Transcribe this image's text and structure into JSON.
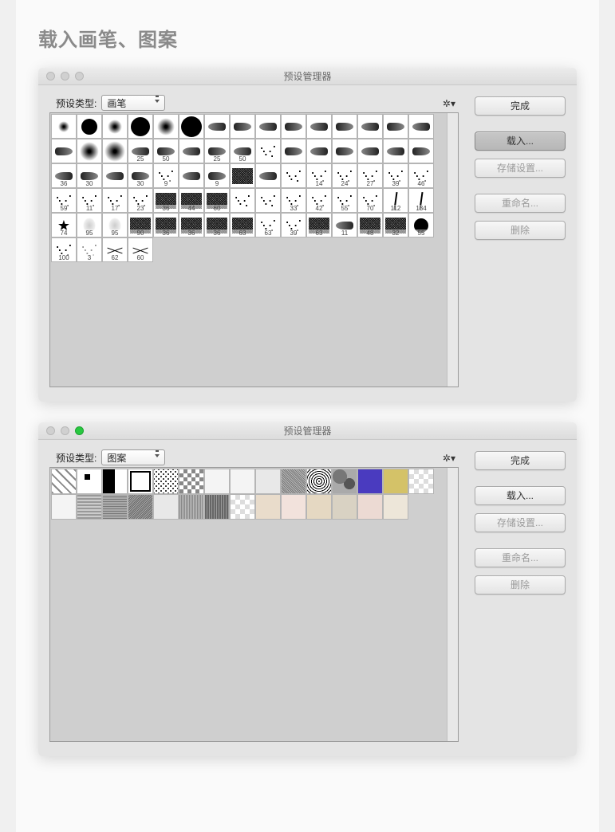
{
  "page": {
    "title": "载入画笔、图案"
  },
  "window1": {
    "title": "预设管理器",
    "type_label": "预设类型:",
    "type_value": "画笔",
    "buttons": {
      "done": "完成",
      "load": "载入...",
      "save": "存储设置...",
      "rename": "重命名...",
      "delete": "删除"
    },
    "brush_sizes_row3": [
      "",
      "",
      "25",
      "50",
      "",
      "25",
      "50",
      "",
      "",
      ""
    ],
    "brush_sizes_row4": [
      "",
      "",
      "36",
      "30",
      "",
      "30",
      "",
      "",
      "",
      ""
    ],
    "brush_sizes_row5": [
      "27",
      "39",
      "46",
      "59",
      "11",
      "17",
      "23",
      "36",
      "44",
      "60",
      "",
      "",
      "",
      ""
    ],
    "brush_sizes_row6": [
      "55",
      "70",
      "112",
      "134",
      "74",
      "95",
      "95",
      "90",
      "36",
      "36",
      "36",
      "63",
      "",
      ""
    ],
    "brush_sizes_row7": [
      "63",
      "11",
      "48",
      "32",
      "55",
      "100",
      "3",
      "62",
      "60"
    ],
    "brush_sizes_extra": [
      "9",
      "14",
      "24",
      "33",
      "42",
      "63",
      "39"
    ]
  },
  "window2": {
    "title": "预设管理器",
    "type_label": "预设类型:",
    "type_value": "图案",
    "buttons": {
      "done": "完成",
      "load": "载入...",
      "save": "存储设置...",
      "rename": "重命名...",
      "delete": "删除"
    }
  }
}
